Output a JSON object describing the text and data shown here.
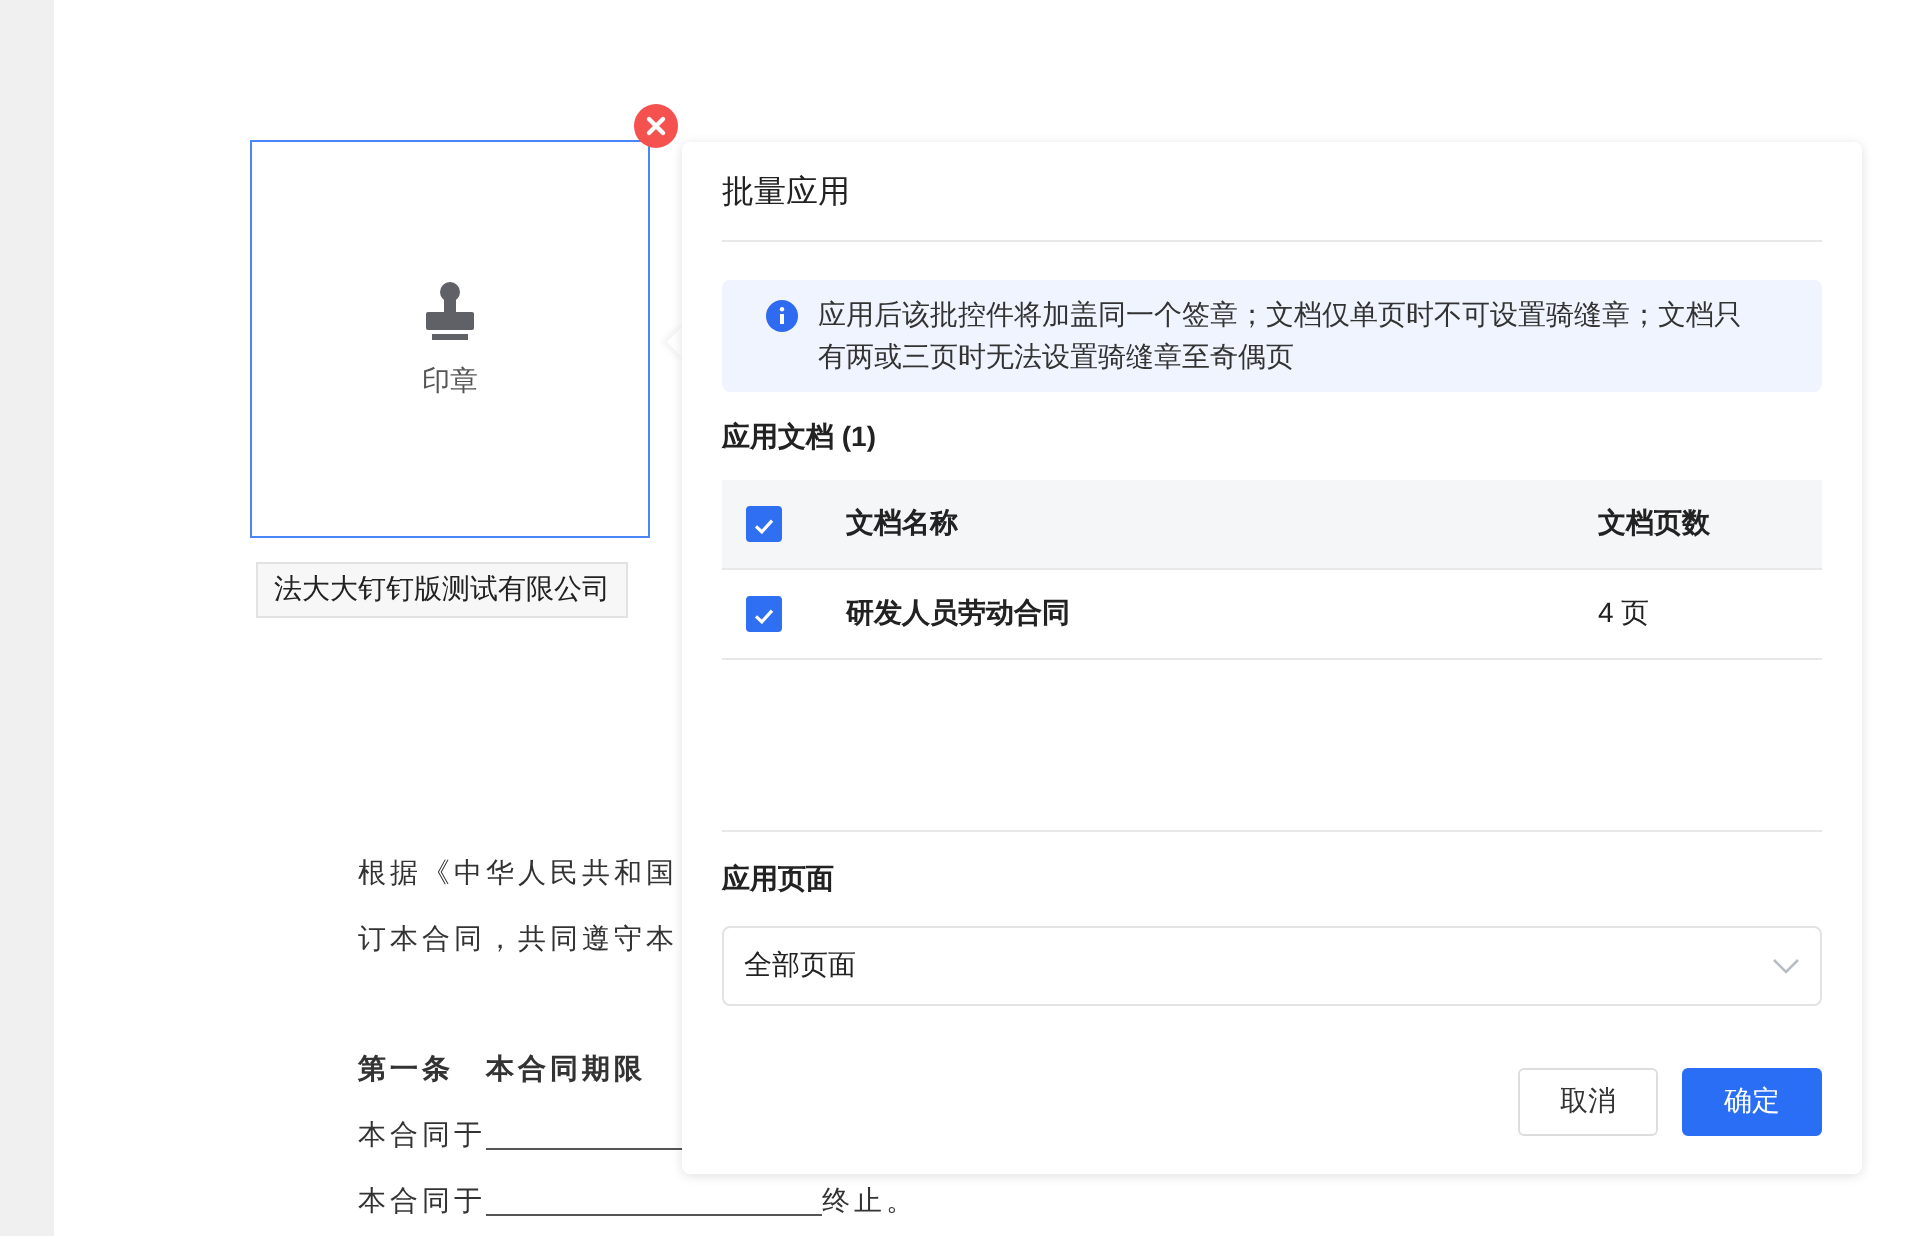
{
  "document": {
    "sections": [
      [
        {
          "kind": "plain",
          "text": "根据《中华人民共和国"
        },
        {
          "kind": "plain",
          "text": "订本合同，共同遵守本"
        }
      ],
      [
        {
          "kind": "bold",
          "text": "第一条　本合同期限"
        },
        {
          "kind": "fill",
          "text": "本合同于"
        },
        {
          "kind": "fill",
          "text": "本合同于",
          "after": "终止。"
        }
      ]
    ]
  },
  "seal": {
    "label": "印章",
    "selected": true
  },
  "company_tag": "法大大钉钉版测试有限公司",
  "dialog": {
    "title": "批量应用",
    "notice": "应用后该批控件将加盖同一个签章；文档仅单页时不可设置骑缝章；文档只有两或三页时无法设置骑缝章至奇偶页",
    "documents_heading": "应用文档 (1)",
    "table": {
      "all_checked": true,
      "columns": [
        "文档名称",
        "文档页数"
      ],
      "rows": [
        {
          "checked": true,
          "name": "研发人员劳动合同",
          "pages": "4 页"
        }
      ]
    },
    "pages_heading": "应用页面",
    "pages_select": {
      "value": "全部页面"
    },
    "buttons": [
      {
        "kind": "secondary",
        "label": "取消"
      },
      {
        "kind": "primary",
        "label": "确定"
      }
    ]
  }
}
